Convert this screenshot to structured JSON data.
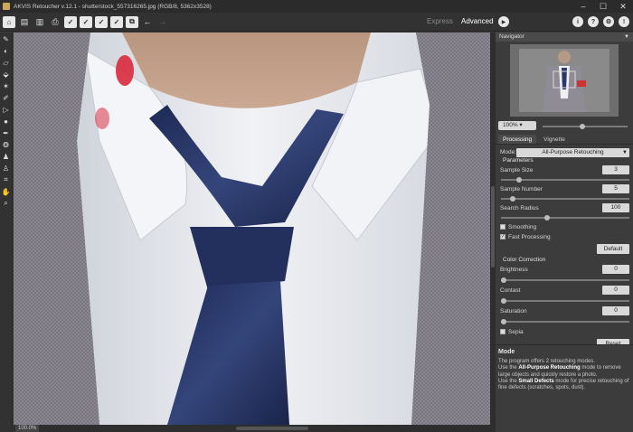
{
  "titlebar": {
    "title": "AKVIS Retoucher v.12.1 - shutterstock_557316265.jpg (RGB/8, 5362x3528)",
    "minimize": "–",
    "maximize": "☐",
    "close": "✕"
  },
  "toolbar": {
    "mode_express": "Express",
    "mode_advanced": "Advanced"
  },
  "navigator": {
    "title": "Navigator",
    "zoom": "100%"
  },
  "tabs": {
    "processing": "Processing",
    "vignette": "Vignette"
  },
  "processing": {
    "mode_label": "Mode:",
    "mode_value": "All-Purpose Retouching",
    "parameters_title": "Parameters",
    "sample_size_label": "Sample Size",
    "sample_size_value": "3",
    "sample_number_label": "Sample Number",
    "sample_number_value": "5",
    "search_radius_label": "Search Radius",
    "search_radius_value": "100",
    "smoothing_label": "Smoothing",
    "fast_processing_label": "Fast Processing",
    "default_button": "Default",
    "color_correction_title": "Color Correction",
    "brightness_label": "Brightness",
    "brightness_value": "0",
    "contrast_label": "Contast",
    "contrast_value": "0",
    "saturation_label": "Saturation",
    "saturation_value": "0",
    "sepia_label": "Sepia",
    "reset_button": "Reset"
  },
  "help": {
    "title": "Mode",
    "line1": "The program offers 2 retouching modes.",
    "line2a": "Use the ",
    "line2b": "All-Purpose Retouching",
    "line2c": " mode to remove large objects and quickly restore a photo.",
    "line3a": "Use the ",
    "line3b": "Small Defects",
    "line3c": " mode for precise retouching of fine defects (scratches, spots, dust)."
  },
  "status": {
    "zoom": "100.0%"
  }
}
